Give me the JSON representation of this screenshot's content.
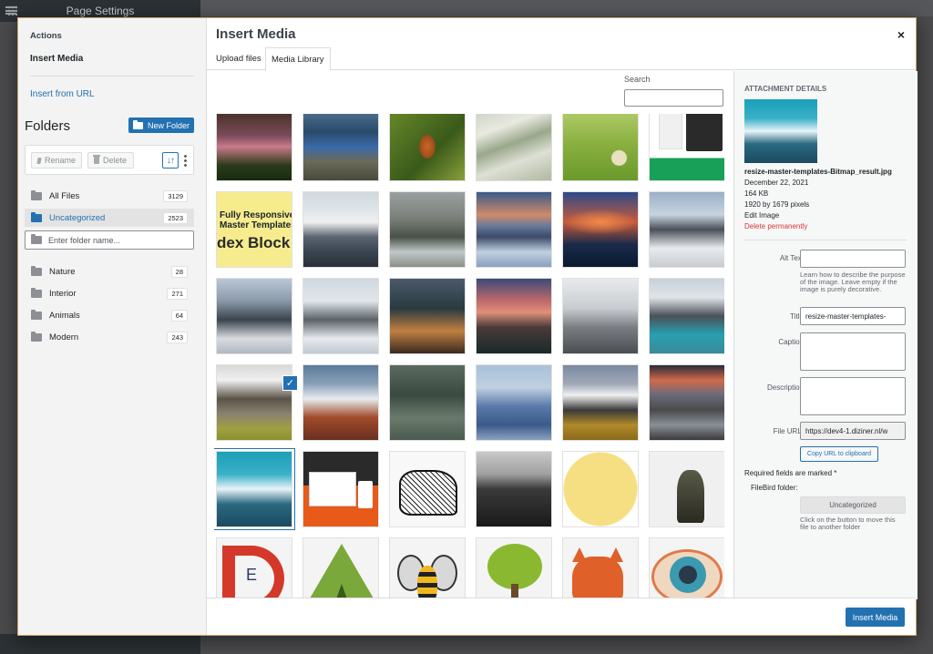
{
  "background": {
    "panel_title": "Page Settings"
  },
  "sidebar": {
    "actions_title": "Actions",
    "insert_media": "Insert Media",
    "insert_from_url": "Insert from URL",
    "folders_title": "Folders",
    "new_folder_label": "New Folder",
    "rename_label": "Rename",
    "delete_label": "Delete",
    "sort_label": "↓↑",
    "folders_top": [
      {
        "label": "All Files",
        "count": "3129",
        "icon": "all-files-icon"
      },
      {
        "label": "Uncategorized",
        "count": "2523",
        "icon": "uncategorized-folder-icon",
        "active": true
      }
    ],
    "new_folder_placeholder": "Enter folder name...",
    "folders": [
      {
        "label": "Nature",
        "count": "28"
      },
      {
        "label": "Interior",
        "count": "271"
      },
      {
        "label": "Animals",
        "count": "64"
      },
      {
        "label": "Modern",
        "count": "243"
      }
    ]
  },
  "modal": {
    "title": "Insert Media",
    "close": "×",
    "tabs": [
      {
        "label": "Upload files"
      },
      {
        "label": "Media Library",
        "active": true
      }
    ],
    "search_label": "Search",
    "insert_button": "Insert Media"
  },
  "details": {
    "title": "ATTACHMENT DETAILS",
    "filename": "resize-master-templates-Bitmap_result.jpg",
    "date": "December 22, 2021",
    "size": "164 KB",
    "dimensions": "1920 by 1679 pixels",
    "edit_image": "Edit Image",
    "delete_permanently": "Delete permanently",
    "alt_text_label": "Alt Text",
    "alt_help": "Learn how to describe the purpose of the image. Leave empty if the image is purely decorative.",
    "title_label": "Title",
    "title_value": "resize-master-templates-",
    "caption_label": "Caption",
    "description_label": "Description",
    "file_url_label": "File URL:",
    "file_url_value": "https://dev4-1.diziner.nl/w",
    "copy_url_label": "Copy URL to clipboard",
    "required_note": "Required fields are marked *",
    "filebird_label": "FileBird folder:",
    "filebird_folder": "Uncategorized",
    "filebird_help": "Click on the button to move this file to another folder"
  },
  "grid_texts": {
    "responsive_line1": "Fully Responsive",
    "responsive_line2": "Master Templates",
    "responsive_line3": "dex Block",
    "logo_letter": "E"
  },
  "colors": {
    "accent": "#2271b1",
    "danger": "#d63638"
  }
}
